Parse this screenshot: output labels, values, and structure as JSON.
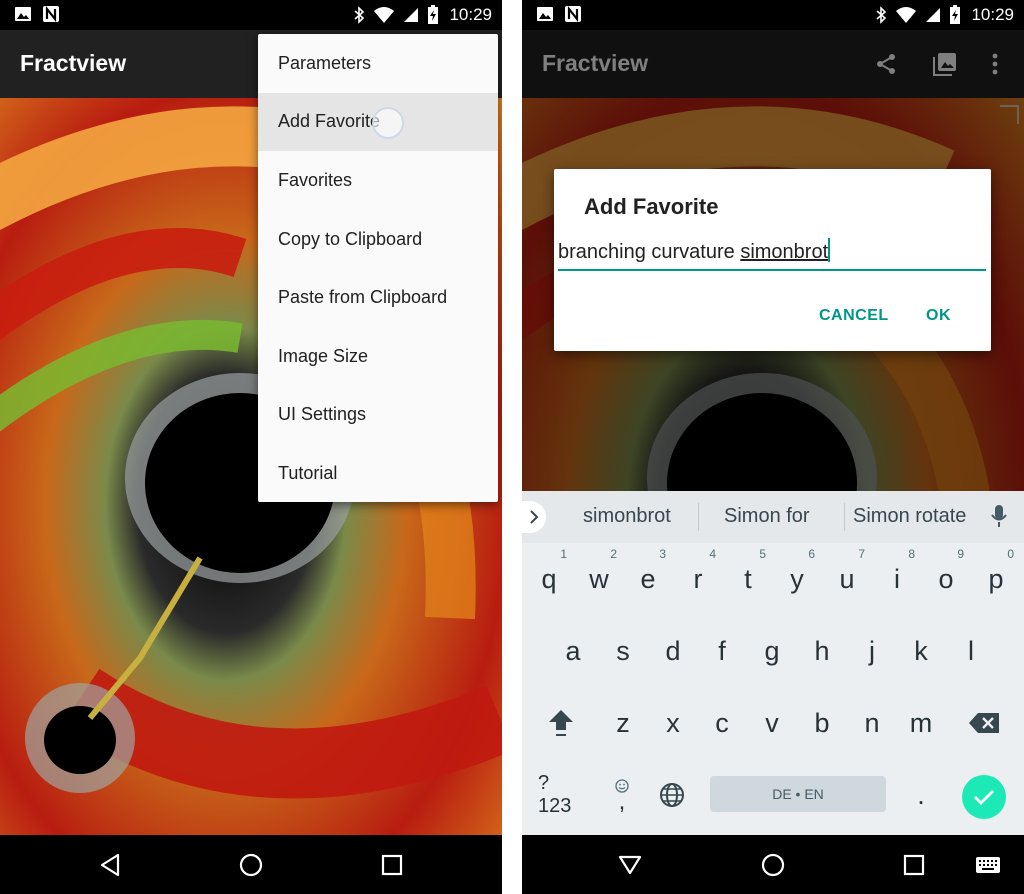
{
  "status_bar": {
    "time": "10:29"
  },
  "left": {
    "app_title": "Fractview",
    "menu_items": [
      {
        "label": "Parameters"
      },
      {
        "label": "Add Favorite"
      },
      {
        "label": "Favorites"
      },
      {
        "label": "Copy to Clipboard"
      },
      {
        "label": "Paste from Clipboard"
      },
      {
        "label": "Image Size"
      },
      {
        "label": "UI Settings"
      },
      {
        "label": "Tutorial"
      }
    ]
  },
  "right": {
    "app_title": "Fractview",
    "dialog": {
      "title": "Add Favorite",
      "input_value_plain": "branching curvature ",
      "input_value_underlined": "simonbrot",
      "cancel": "CANCEL",
      "ok": "OK"
    },
    "keyboard": {
      "suggestions": [
        "simonbrot",
        "Simon for",
        "Simon rotate"
      ],
      "row1": [
        {
          "k": "q",
          "h": "1"
        },
        {
          "k": "w",
          "h": "2"
        },
        {
          "k": "e",
          "h": "3"
        },
        {
          "k": "r",
          "h": "4"
        },
        {
          "k": "t",
          "h": "5"
        },
        {
          "k": "y",
          "h": "6"
        },
        {
          "k": "u",
          "h": "7"
        },
        {
          "k": "i",
          "h": "8"
        },
        {
          "k": "o",
          "h": "9"
        },
        {
          "k": "p",
          "h": "0"
        }
      ],
      "row2": [
        "a",
        "s",
        "d",
        "f",
        "g",
        "h",
        "j",
        "k",
        "l"
      ],
      "row3": [
        "z",
        "x",
        "c",
        "v",
        "b",
        "n",
        "m"
      ],
      "symbols_key": "?123",
      "comma_key": ",",
      "period_key": ".",
      "space_label": "DE • EN"
    }
  },
  "colors": {
    "accent": "#009688",
    "appbar": "#212121",
    "menu_bg": "#fafafa",
    "keyboard_bg": "#eceff1",
    "enter_key": "#1de9b6"
  }
}
